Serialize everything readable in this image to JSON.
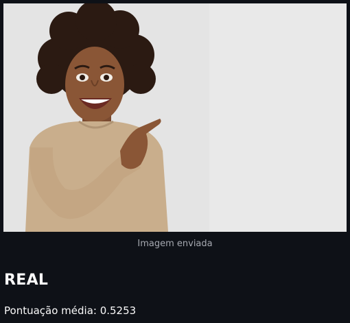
{
  "uploaded_image": {
    "caption": "Imagem enviada"
  },
  "result": {
    "label": "REAL",
    "score_label": "Pontuação média: 0.5253"
  }
}
